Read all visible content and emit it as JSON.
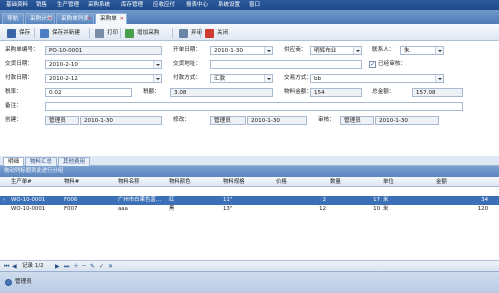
{
  "menu": [
    "基础资料",
    "销售",
    "生产管理",
    "采购系统",
    "库存管理",
    "应收应付",
    "报表中心",
    "系统设置",
    "窗口"
  ],
  "tabs": [
    {
      "label": "导航",
      "active": false,
      "closable": false
    },
    {
      "label": "采购计划",
      "active": false,
      "closable": true
    },
    {
      "label": "采购单列表",
      "active": false,
      "closable": true
    },
    {
      "label": "采购单",
      "active": true,
      "closable": true
    }
  ],
  "toolbar": {
    "save": "保存",
    "save_new": "保存并新建",
    "print": "打印",
    "add_purchase": "增加采购",
    "audit": "弃审",
    "close": "关闭"
  },
  "form": {
    "order_no_label": "采购单编号：",
    "order_no": "PO-10-0001",
    "open_date_label": "开单日期：",
    "open_date": "2010-1-30",
    "supplier_label": "供应商：",
    "supplier": "明辉布业",
    "contact_label": "联系人：",
    "contact": "朱",
    "delivery_date_label": "交货日期：",
    "delivery_date": "2010-2-10",
    "delivery_addr_label": "交货地址：",
    "delivery_addr": "",
    "audited_label": "已经审核：",
    "audited": "✓",
    "pay_date_label": "付款日期：",
    "pay_date": "2010-2-12",
    "pay_method_label": "付款方式：",
    "pay_method": "汇款",
    "trade_method_label": "交易方式：",
    "trade_method": "bb",
    "tax_rate_label": "税率：",
    "tax_rate": "0.02",
    "tax_label": "税额：",
    "tax": "3.08",
    "goods_amount_label": "物料金额：",
    "goods_amount": "154",
    "total_label": "总金额：",
    "total": "157.08",
    "remark_label": "备注：",
    "remark": "",
    "creator_label": "创建：",
    "creator": "管理员",
    "created_at": "2010-1-30",
    "modifier_label": "修改：",
    "modifier": "管理员",
    "modified_at": "2010-1-30",
    "auditor_label": "审核：",
    "auditor": "管理员",
    "audited_at": "2010-1-30"
  },
  "subtabs": [
    "明细",
    "物料汇总",
    "其他费用"
  ],
  "group_hint": "拖动列标题到此进行分组",
  "grid": {
    "columns": [
      "生产单#",
      "物料#",
      "物料名称",
      "物料颜色",
      "物料规格",
      "价格",
      "数量",
      "单位",
      "金额"
    ],
    "rows": [
      {
        "marker": "›",
        "prod": "WO-10-0001",
        "item": "F006",
        "name": "广州市白果色蓝…",
        "color": "红",
        "spec": "11\"",
        "price": "2",
        "qty": "17",
        "unit": "米",
        "amount": "34",
        "selected": true
      },
      {
        "marker": "",
        "prod": "WO-10-0001",
        "item": "F007",
        "name": "aaa",
        "color": "黑",
        "spec": "13\"",
        "price": "12",
        "qty": "10",
        "unit": "米",
        "amount": "120",
        "selected": false
      }
    ]
  },
  "pager": {
    "record": "记录 1/2"
  },
  "status": {
    "user": "管理员"
  },
  "colors": {
    "menubar": "#1d4a8a",
    "selected_row": "#3b6fb6",
    "accent": "#5c86bf"
  }
}
